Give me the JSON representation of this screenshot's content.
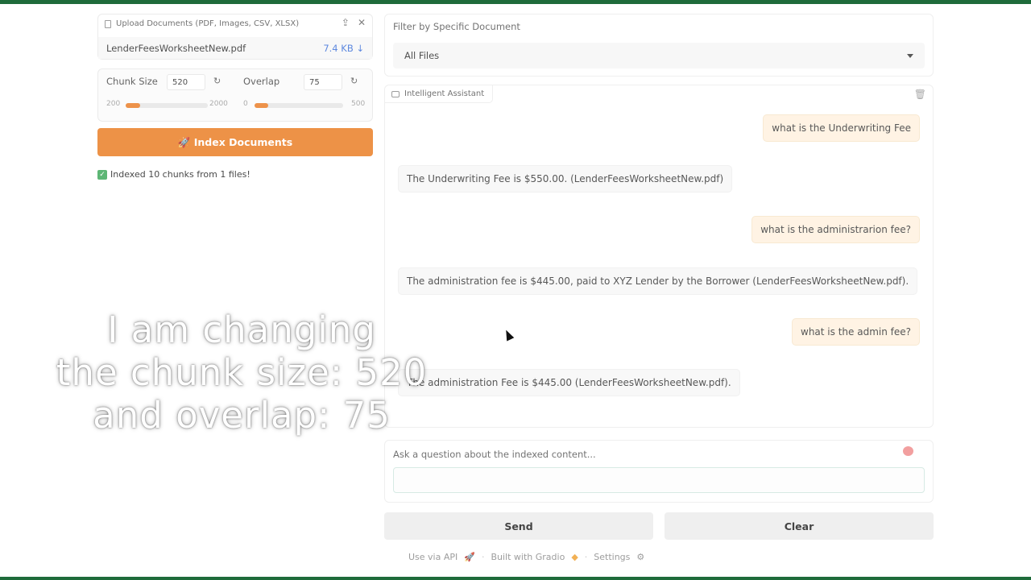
{
  "upload": {
    "label": "Upload Documents (PDF, Images, CSV, XLSX)",
    "file_name": "LenderFeesWorksheetNew.pdf",
    "file_size": "7.4 KB ↓"
  },
  "params": {
    "chunk_size": {
      "label": "Chunk Size",
      "value": "520",
      "min": "200",
      "max": "2000",
      "fraction": 0.18
    },
    "overlap": {
      "label": "Overlap",
      "value": "75",
      "min": "0",
      "max": "500",
      "fraction": 0.15
    }
  },
  "index_button": {
    "icon": "rocket-icon",
    "label": "🚀 Index Documents"
  },
  "status": "Indexed 10 chunks from 1 files!",
  "filter": {
    "label": "Filter by Specific Document",
    "selected": "All Files"
  },
  "chat": {
    "tag": "Intelligent Assistant",
    "messages": [
      {
        "role": "user",
        "text": "what is the Underwriting Fee"
      },
      {
        "role": "bot",
        "text": "The Underwriting Fee is $550.00. (LenderFeesWorksheetNew.pdf)"
      },
      {
        "role": "user",
        "text": "what is the administrarion fee?"
      },
      {
        "role": "bot",
        "text": "The administration fee is $445.00, paid to XYZ Lender by the Borrower (LenderFeesWorksheetNew.pdf)."
      },
      {
        "role": "user",
        "text": "what is the admin fee?"
      },
      {
        "role": "bot",
        "text": "The administration Fee is $445.00 (LenderFeesWorksheetNew.pdf)."
      }
    ]
  },
  "ask": {
    "label": "Ask a question about the indexed content...",
    "value": ""
  },
  "buttons": {
    "send": "Send",
    "clear": "Clear"
  },
  "footer": {
    "api": "Use via API",
    "built": "Built with Gradio",
    "settings": "Settings",
    "sep": "·"
  },
  "caption": {
    "line1": "I am changing",
    "line2": "the chunk size: 520",
    "line3": "and overlap: 75"
  },
  "colors": {
    "accent": "#ea7a1f",
    "user_bubble": "#fff1df",
    "frame_border": "#1e6b3a"
  }
}
